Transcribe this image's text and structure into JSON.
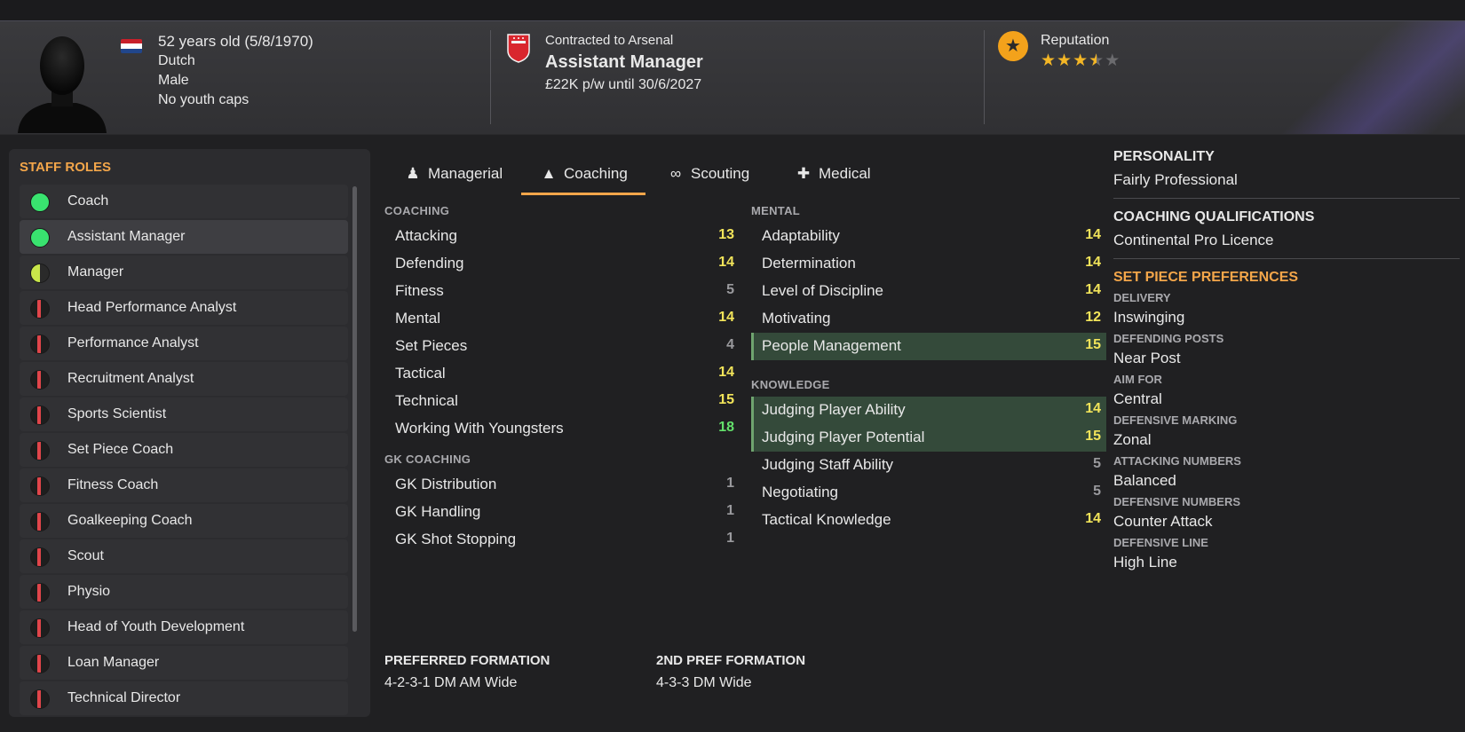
{
  "header": {
    "age": "52 years old (5/8/1970)",
    "nationality": "Dutch",
    "gender": "Male",
    "youth_caps": "No youth caps",
    "contract_text": "Contracted to Arsenal",
    "role": "Assistant Manager",
    "wage": "£22K p/w until 30/6/2027",
    "reputation_label": "Reputation",
    "reputation_stars": 3.5,
    "reputation_max": 5
  },
  "staff_roles": {
    "title": "STAFF ROLES",
    "items": [
      {
        "label": "Coach",
        "status": "green"
      },
      {
        "label": "Assistant Manager",
        "status": "green",
        "selected": true
      },
      {
        "label": "Manager",
        "status": "half"
      },
      {
        "label": "Head Performance Analyst",
        "status": "red"
      },
      {
        "label": "Performance Analyst",
        "status": "red"
      },
      {
        "label": "Recruitment Analyst",
        "status": "red"
      },
      {
        "label": "Sports Scientist",
        "status": "red"
      },
      {
        "label": "Set Piece Coach",
        "status": "red"
      },
      {
        "label": "Fitness Coach",
        "status": "red"
      },
      {
        "label": "Goalkeeping Coach",
        "status": "red"
      },
      {
        "label": "Scout",
        "status": "red"
      },
      {
        "label": "Physio",
        "status": "red"
      },
      {
        "label": "Head of Youth Development",
        "status": "red"
      },
      {
        "label": "Loan Manager",
        "status": "red"
      },
      {
        "label": "Technical Director",
        "status": "red"
      }
    ]
  },
  "tabs": [
    {
      "label": "Managerial",
      "icon": "manager-icon"
    },
    {
      "label": "Coaching",
      "icon": "cone-icon",
      "active": true
    },
    {
      "label": "Scouting",
      "icon": "binoculars-icon"
    },
    {
      "label": "Medical",
      "icon": "medical-kit-icon"
    }
  ],
  "coaching": {
    "heading": "COACHING",
    "attributes": [
      {
        "name": "Attacking",
        "value": 13
      },
      {
        "name": "Defending",
        "value": 14
      },
      {
        "name": "Fitness",
        "value": 5
      },
      {
        "name": "Mental",
        "value": 14
      },
      {
        "name": "Set Pieces",
        "value": 4
      },
      {
        "name": "Tactical",
        "value": 14
      },
      {
        "name": "Technical",
        "value": 15
      },
      {
        "name": "Working With Youngsters",
        "value": 18
      }
    ]
  },
  "gk_coaching": {
    "heading": "GK COACHING",
    "attributes": [
      {
        "name": "GK Distribution",
        "value": 1
      },
      {
        "name": "GK Handling",
        "value": 1
      },
      {
        "name": "GK Shot Stopping",
        "value": 1
      }
    ]
  },
  "mental": {
    "heading": "MENTAL",
    "attributes": [
      {
        "name": "Adaptability",
        "value": 14
      },
      {
        "name": "Determination",
        "value": 14
      },
      {
        "name": "Level of Discipline",
        "value": 14
      },
      {
        "name": "Motivating",
        "value": 12
      },
      {
        "name": "People Management",
        "value": 15,
        "highlight": true
      }
    ]
  },
  "knowledge": {
    "heading": "KNOWLEDGE",
    "attributes": [
      {
        "name": "Judging Player Ability",
        "value": 14,
        "highlight": true
      },
      {
        "name": "Judging Player Potential",
        "value": 15,
        "highlight": true
      },
      {
        "name": "Judging Staff Ability",
        "value": 5
      },
      {
        "name": "Negotiating",
        "value": 5
      },
      {
        "name": "Tactical Knowledge",
        "value": 14
      }
    ]
  },
  "formations": {
    "preferred_label": "PREFERRED FORMATION",
    "preferred_value": "4-2-3-1 DM AM Wide",
    "second_label": "2ND PREF FORMATION",
    "second_value": "4-3-3 DM Wide"
  },
  "personality": {
    "label": "PERSONALITY",
    "value": "Fairly Professional"
  },
  "qualifications": {
    "label": "COACHING QUALIFICATIONS",
    "value": "Continental Pro Licence"
  },
  "set_piece": {
    "title": "SET PIECE PREFERENCES",
    "items": [
      {
        "label": "DELIVERY",
        "value": "Inswinging"
      },
      {
        "label": "DEFENDING POSTS",
        "value": "Near Post"
      },
      {
        "label": "AIM FOR",
        "value": "Central"
      },
      {
        "label": "DEFENSIVE MARKING",
        "value": "Zonal"
      },
      {
        "label": "ATTACKING NUMBERS",
        "value": "Balanced"
      },
      {
        "label": "DEFENSIVE NUMBERS",
        "value": "Counter Attack"
      },
      {
        "label": "DEFENSIVE LINE",
        "value": "High Line"
      }
    ]
  },
  "colors": {
    "accent": "#f3a64a",
    "value_low": "#9a9a9e",
    "value_mid": "#f2e45a",
    "value_high": "#63e06b",
    "highlight_row": "#344a3a"
  }
}
